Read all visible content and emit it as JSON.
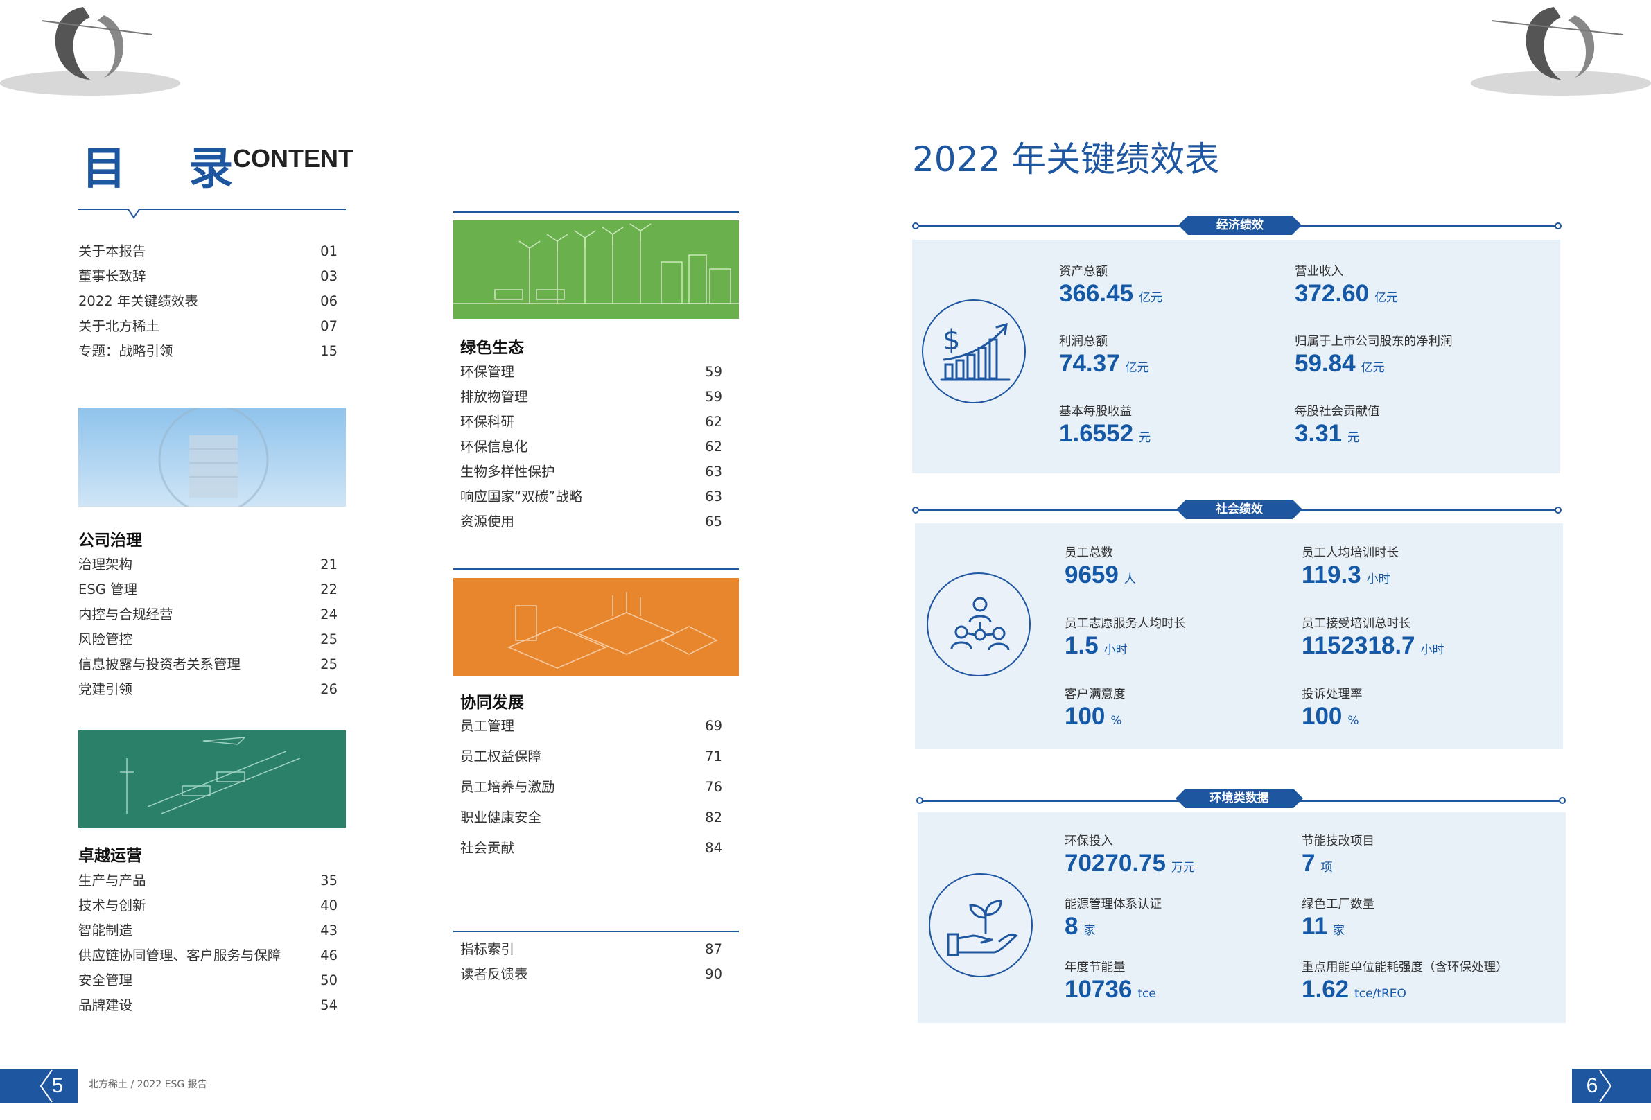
{
  "toc": {
    "title": "目 录",
    "title_en": "CONTENT",
    "top_items": [
      {
        "label": "关于本报告",
        "page": "01"
      },
      {
        "label": "董事长致辞",
        "page": "03"
      },
      {
        "label": "2022 年关键绩效表",
        "page": "06"
      },
      {
        "label": "关于北方稀土",
        "page": "07"
      },
      {
        "label": "专题：战略引领",
        "page": "15"
      }
    ],
    "governance": {
      "heading": "公司治理",
      "items": [
        {
          "label": "治理架构",
          "page": "21"
        },
        {
          "label": "ESG 管理",
          "page": "22"
        },
        {
          "label": "内控与合规经营",
          "page": "24"
        },
        {
          "label": "风险管控",
          "page": "25"
        },
        {
          "label": "信息披露与投资者关系管理",
          "page": "25"
        },
        {
          "label": "党建引领",
          "page": "26"
        }
      ]
    },
    "operations": {
      "heading": "卓越运营",
      "items": [
        {
          "label": "生产与产品",
          "page": "35"
        },
        {
          "label": "技术与创新",
          "page": "40"
        },
        {
          "label": "智能制造",
          "page": "43"
        },
        {
          "label": "供应链协同管理、客户服务与保障",
          "page": "46"
        },
        {
          "label": "安全管理",
          "page": "50"
        },
        {
          "label": "品牌建设",
          "page": "54"
        }
      ]
    },
    "green": {
      "heading": "绿色生态",
      "items": [
        {
          "label": "环保管理",
          "page": "59"
        },
        {
          "label": "排放物管理",
          "page": "59"
        },
        {
          "label": "环保科研",
          "page": "62"
        },
        {
          "label": "环保信息化",
          "page": "62"
        },
        {
          "label": "生物多样性保护",
          "page": "63"
        },
        {
          "label": "响应国家“双碳”战略",
          "page": "63"
        },
        {
          "label": "资源使用",
          "page": "65"
        }
      ]
    },
    "synergy": {
      "heading": "协同发展",
      "items": [
        {
          "label": "员工管理",
          "page": "69"
        },
        {
          "label": "员工权益保障",
          "page": "71"
        },
        {
          "label": "员工培养与激励",
          "page": "76"
        },
        {
          "label": "职业健康安全",
          "page": "82"
        },
        {
          "label": "社会贡献",
          "page": "84"
        }
      ]
    },
    "appendix": [
      {
        "label": "指标索引",
        "page": "87"
      },
      {
        "label": "读者反馈表",
        "page": "90"
      }
    ]
  },
  "kpi": {
    "title": "2022 年关键绩效表",
    "economic": {
      "tag": "经济绩效",
      "items": [
        {
          "label": "资产总额",
          "value": "366.45",
          "unit": "亿元"
        },
        {
          "label": "营业收入",
          "value": "372.60",
          "unit": "亿元"
        },
        {
          "label": "利润总额",
          "value": "74.37",
          "unit": "亿元"
        },
        {
          "label": "归属于上市公司股东的净利润",
          "value": "59.84",
          "unit": "亿元"
        },
        {
          "label": "基本每股收益",
          "value": "1.6552",
          "unit": "元"
        },
        {
          "label": "每股社会贡献值",
          "value": "3.31",
          "unit": "元"
        }
      ]
    },
    "social": {
      "tag": "社会绩效",
      "items": [
        {
          "label": "员工总数",
          "value": "9659",
          "unit": "人"
        },
        {
          "label": "员工人均培训时长",
          "value": "119.3",
          "unit": "小时"
        },
        {
          "label": "员工志愿服务人均时长",
          "value": "1.5",
          "unit": "小时"
        },
        {
          "label": "员工接受培训总时长",
          "value": "1152318.7",
          "unit": "小时"
        },
        {
          "label": "客户满意度",
          "value": "100",
          "unit": "%"
        },
        {
          "label": "投诉处理率",
          "value": "100",
          "unit": "%"
        }
      ]
    },
    "environment": {
      "tag": "环境类数据",
      "items": [
        {
          "label": "环保投入",
          "value": "70270.75",
          "unit": "万元"
        },
        {
          "label": "节能技改项目",
          "value": "7",
          "unit": "项"
        },
        {
          "label": "能源管理体系认证",
          "value": "8",
          "unit": "家"
        },
        {
          "label": "绿色工厂数量",
          "value": "11",
          "unit": "家"
        },
        {
          "label": "年度节能量",
          "value": "10736",
          "unit": "tce"
        },
        {
          "label": "重点用能单位能耗强度（含环保处理）",
          "value": "1.62",
          "unit": "tce/tREO"
        }
      ]
    }
  },
  "footer": {
    "left_page": "5",
    "left_text": "北方稀土 / 2022 ESG 报告",
    "right_page": "6"
  },
  "colors": {
    "accent": "#1e56a0",
    "panel": "#e8f0f8",
    "green": "#6ab04c",
    "orange": "#e8862e",
    "teal": "#2a8068"
  }
}
